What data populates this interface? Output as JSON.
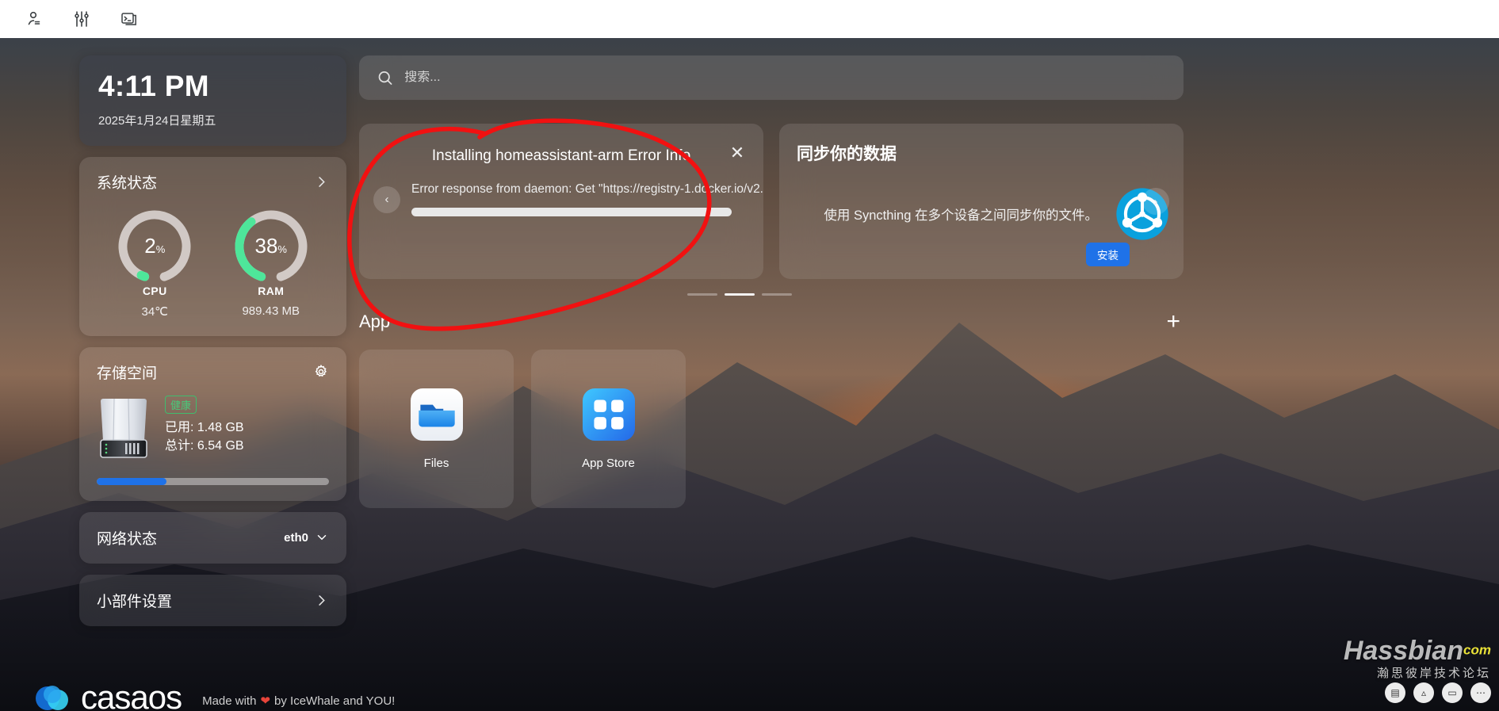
{
  "topbar": {
    "icons": [
      {
        "name": "user-profile-icon",
        "label": "account"
      },
      {
        "name": "sliders-settings-icon",
        "label": "settings"
      },
      {
        "name": "terminal-icon",
        "label": "terminal"
      }
    ]
  },
  "clock": {
    "time": "4:11 PM",
    "date": "2025年1月24日星期五"
  },
  "system": {
    "title": "系统状态",
    "cpu": {
      "label": "CPU",
      "value": "2",
      "unit": "%",
      "percent": 2,
      "sub": "34℃"
    },
    "ram": {
      "label": "RAM",
      "value": "38",
      "unit": "%",
      "percent": 38,
      "sub": "989.43 MB"
    }
  },
  "storage": {
    "title": "存储空间",
    "health_badge": "健康",
    "used_line": "已用: 1.48 GB",
    "total_line": "总计: 6.54 GB",
    "used_percent": 30
  },
  "network": {
    "title": "网络状态",
    "interface": "eth0"
  },
  "widget_settings": {
    "title": "小部件设置"
  },
  "search": {
    "placeholder": "搜索...",
    "value": ""
  },
  "error_banner": {
    "title": "Installing homeassistant-arm Error Info",
    "message": "Error response from daemon: Get \"https://registry-1.docker.io/v2...",
    "close_label": "✕",
    "prev_label": "‹"
  },
  "sync_banner": {
    "title": "同步你的数据",
    "description": "使用 Syncthing 在多个设备之间同步你的文件。",
    "install_label": "安装",
    "next_label": "›",
    "logo_color": "#0aa1dd"
  },
  "carousel": {
    "dots": 3,
    "active_index": 1
  },
  "app_section": {
    "label": "App",
    "add_label": "+",
    "apps": [
      {
        "name": "Files",
        "icon": "folder-icon"
      },
      {
        "name": "App Store",
        "icon": "grid-apps-icon"
      }
    ]
  },
  "footer": {
    "brand": "casaos",
    "made_with_prefix": "Made with",
    "made_with_suffix": "by IceWhale and YOU!"
  },
  "watermark": {
    "main": "Hassbian",
    "tld": "com",
    "sub": "瀚思彼岸技术论坛"
  },
  "colors": {
    "accent_blue": "#1f72e8",
    "health_green": "#49c97a",
    "gauge_green": "#4ee69a",
    "annotation_red": "#f11111"
  }
}
